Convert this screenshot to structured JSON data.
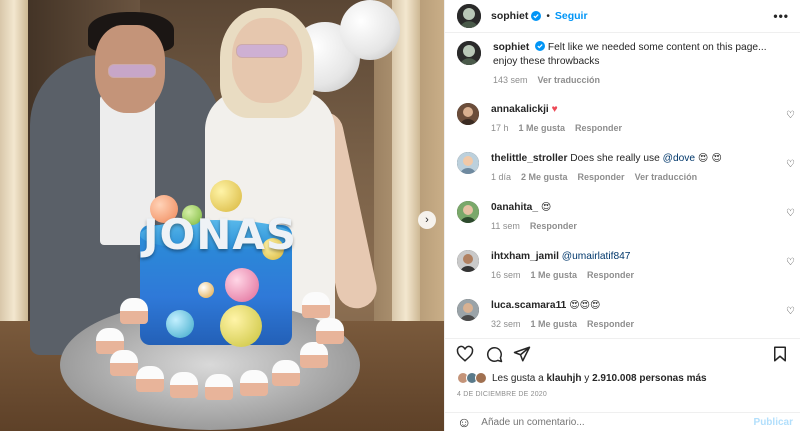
{
  "post": {
    "username": "sophiet",
    "follow_label": "Seguir",
    "more_label": "•••",
    "caption": "Felt like we needed some content on this page... enjoy these throwbacks",
    "caption_age": "143 sem",
    "caption_translate": "Ver traducción",
    "cake_text": "JONAS",
    "likes_prefix": "Les gusta a",
    "likes_user": "klauhjh",
    "likes_middle": "y",
    "likes_count": "2.910.008 personas más",
    "date": "4 DE DICIEMBRE DE 2020"
  },
  "comments": [
    {
      "user": "annakalickji",
      "text": "",
      "extra": "♥",
      "age": "17 h",
      "likes": "1 Me gusta",
      "reply": "Responder",
      "translate": ""
    },
    {
      "user": "thelittle_stroller",
      "text": "Does she really use",
      "mention": "@dove",
      "extra": "😍 😍",
      "age": "1 día",
      "likes": "2 Me gusta",
      "reply": "Responder",
      "translate": "Ver traducción"
    },
    {
      "user": "0anahita_",
      "text": "",
      "extra": "😍",
      "age": "11 sem",
      "likes": "",
      "reply": "Responder",
      "translate": ""
    },
    {
      "user": "ihtxham_jamil",
      "text": "",
      "mention": "@umairlatif847",
      "extra": "",
      "age": "16 sem",
      "likes": "1 Me gusta",
      "reply": "Responder",
      "translate": ""
    },
    {
      "user": "luca.scamara11",
      "text": "",
      "extra": "😍😍😍",
      "age": "32 sem",
      "likes": "1 Me gusta",
      "reply": "Responder",
      "translate": ""
    }
  ],
  "add_comment": {
    "placeholder": "Añade un comentario...",
    "publish_label": "Publicar"
  },
  "colors": {
    "accent": "#0095f6",
    "heart": "#ed4956",
    "muted": "#8e8e8e"
  }
}
